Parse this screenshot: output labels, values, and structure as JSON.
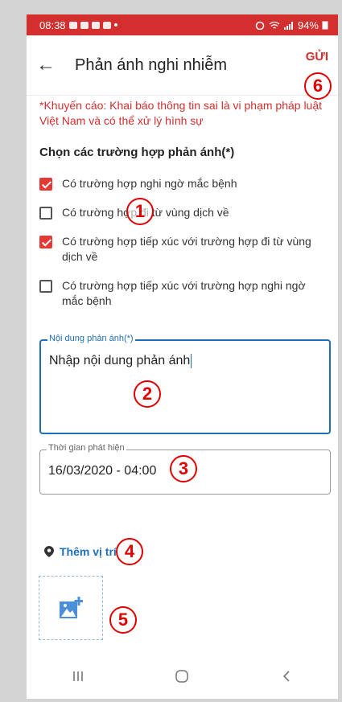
{
  "status": {
    "time": "08:38",
    "battery": "94%"
  },
  "appbar": {
    "title": "Phản ánh nghi nhiễm",
    "send": "GỬI"
  },
  "warning": "*Khuyến cáo: Khai báo thông tin sai là vi phạm pháp luật Việt Nam và có thể xử lý hình sự",
  "section": "Chọn các trường hợp phản ánh(*)",
  "options": [
    {
      "label": "Có trường hợp nghi ngờ mắc bệnh",
      "checked": true
    },
    {
      "label": "Có trường hợp đi từ vùng dịch về",
      "checked": false
    },
    {
      "label": "Có trường hợp tiếp xúc với trường hợp đi từ vùng dịch về",
      "checked": true
    },
    {
      "label": "Có trường hợp tiếp xúc với trường hợp nghi ngờ mắc bệnh",
      "checked": false
    }
  ],
  "content_field": {
    "label": "Nội dung phản ánh(*)",
    "value": "Nhập nội dung phản ánh"
  },
  "time_field": {
    "label": "Thời gian phát hiện",
    "value": "16/03/2020 - 04:00"
  },
  "location": {
    "label": "Thêm vị trí",
    "icon": "location-pin-icon"
  },
  "photo": {
    "icon": "add-photo-icon"
  },
  "badges": [
    "1",
    "2",
    "3",
    "4",
    "5",
    "6"
  ],
  "colors": {
    "primary": "#d32f2f",
    "accent": "#1e6fb8",
    "annotation": "#e00000"
  }
}
